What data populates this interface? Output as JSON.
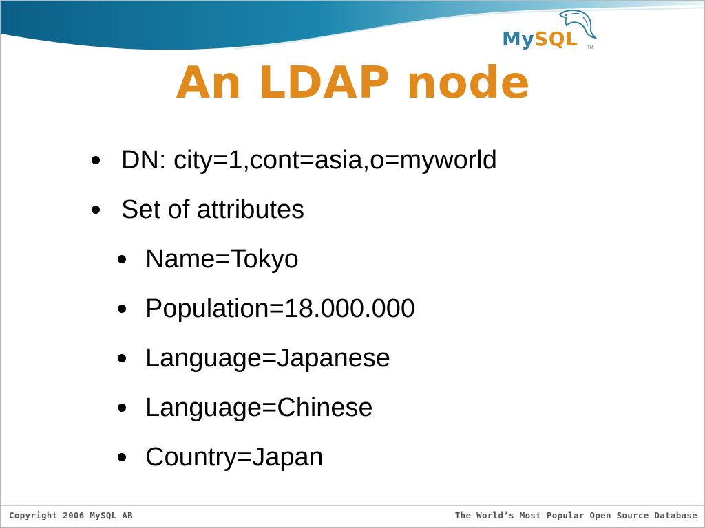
{
  "slide": {
    "title": "An LDAP node",
    "bullets": [
      {
        "level": 1,
        "text": "DN: city=1,cont=asia,o=myworld"
      },
      {
        "level": 1,
        "text": "Set of attributes"
      },
      {
        "level": 2,
        "text": "Name=Tokyo"
      },
      {
        "level": 2,
        "text": "Population=18.000.000"
      },
      {
        "level": 2,
        "text": "Language=Japanese"
      },
      {
        "level": 2,
        "text": "Language=Chinese"
      },
      {
        "level": 2,
        "text": "Country=Japan"
      }
    ]
  },
  "logo": {
    "part1": "My",
    "part2": "SQL",
    "tm": "TM",
    "icon": "dolphin-icon"
  },
  "footer": {
    "left": "Copyright 2006 MySQL AB",
    "right": "The World’s Most Popular Open Source Database"
  },
  "colors": {
    "title": "#e08a1e",
    "wave_dark": "#0e6e97",
    "wave_light": "#d6ecf4",
    "logo_blue": "#2e7fa2",
    "logo_orange": "#e48e1a"
  }
}
